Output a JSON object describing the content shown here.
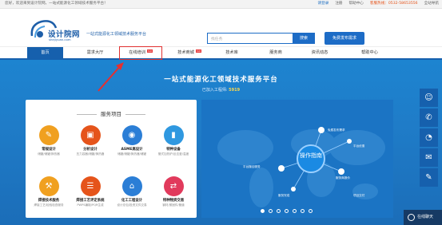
{
  "topbar": {
    "welcome": "您好，欢迎来到设计院网，一站式能源化工领域技术服务平台！",
    "login": "请登录",
    "register": "注册",
    "help": "帮助中心",
    "hotline": "客服热线：0532-58653556",
    "sitemap": "全站导航"
  },
  "header": {
    "logo_name": "设计院网",
    "logo_sub": "shejiyuan.com",
    "tagline": "一站式能源化工领域技术服务平台",
    "search_placeholder": "找任务",
    "search_button": "搜索",
    "post_button": "免费发布需求"
  },
  "nav": {
    "items": [
      {
        "label": "首页"
      },
      {
        "label": "需求大厅"
      },
      {
        "label": "在线培训",
        "badge": "hot"
      },
      {
        "label": "技术商城",
        "badge": "hot"
      },
      {
        "label": "技术库"
      },
      {
        "label": "服务商"
      },
      {
        "label": "资讯动态"
      },
      {
        "label": "帮助中心"
      }
    ]
  },
  "banner": {
    "title": "一站式能源化工领域技术服务平台",
    "engineers_label": "已加入工程师:",
    "engineers_count": "5919"
  },
  "services": {
    "heading": "服务项目",
    "items": [
      {
        "title": "常规设计",
        "desc": "储罐/储罐/换热器",
        "color": "#f0a020",
        "icon": "design-icon"
      },
      {
        "title": "分析设计",
        "desc": "压力容器/储罐/换热器",
        "color": "#e5541b",
        "icon": "analysis-icon"
      },
      {
        "title": "ASME高设计",
        "desc": "储罐/储罐/换热器/储罐",
        "color": "#2b7ed6",
        "icon": "asme-icon"
      },
      {
        "title": "特种设备",
        "desc": "管式加热炉/反应釜/温度",
        "color": "#2f98e0",
        "icon": "equipment-icon"
      },
      {
        "title": "焊接技术服务",
        "desc": "焊接工艺/检验检查服务",
        "color": "#f0a020",
        "icon": "welding-icon"
      },
      {
        "title": "焊接工艺评定系统",
        "desc": "PWPS编制/PQR生成",
        "color": "#e5541b",
        "icon": "wps-icon"
      },
      {
        "title": "化工工程设计",
        "desc": "设计总包/投资文件交易",
        "color": "#2b7ed6",
        "icon": "plant-icon"
      },
      {
        "title": "特种物资交易",
        "desc": "钢材/紧固件/管道",
        "color": "#e13a5c",
        "icon": "trade-icon"
      }
    ]
  },
  "map": {
    "center": "操作指南",
    "nodes": [
      "免费发布需求",
      "平台撮合服务",
      "服务商报价",
      "服务完成",
      "平台优惠",
      "项目交付"
    ]
  },
  "side_buttons": [
    "service-icon",
    "phone-icon",
    "wechat-icon",
    "comment-icon",
    "edit-icon"
  ],
  "chat": {
    "label": "在线聊天"
  },
  "colors": {
    "brand": "#1660ad",
    "accent": "#e5541b",
    "banner": "#1d84d0"
  }
}
